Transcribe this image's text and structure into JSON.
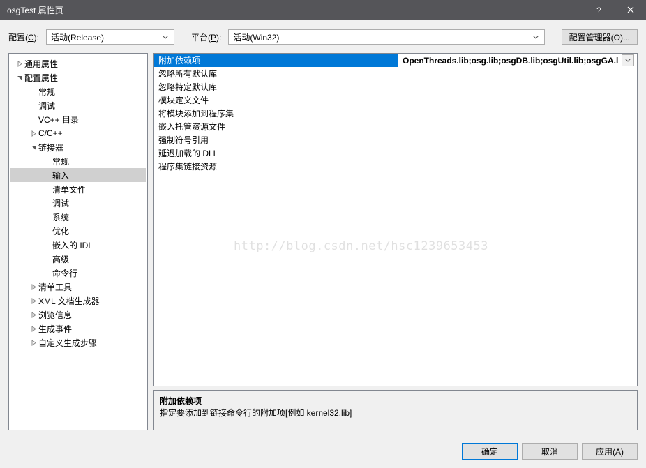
{
  "title": "osgTest 属性页",
  "toolbar": {
    "config_label": "配置(C):",
    "config_value": "活动(Release)",
    "platform_label": "平台(P):",
    "platform_value": "活动(Win32)",
    "manager_label": "配置管理器(O)..."
  },
  "tree": [
    {
      "depth": 0,
      "expander": ">",
      "label": "通用属性",
      "selected": false
    },
    {
      "depth": 0,
      "expander": "v",
      "label": "配置属性",
      "selected": false
    },
    {
      "depth": 1,
      "expander": "",
      "label": "常规",
      "selected": false
    },
    {
      "depth": 1,
      "expander": "",
      "label": "调试",
      "selected": false
    },
    {
      "depth": 1,
      "expander": "",
      "label": "VC++ 目录",
      "selected": false
    },
    {
      "depth": 1,
      "expander": ">",
      "label": "C/C++",
      "selected": false
    },
    {
      "depth": 1,
      "expander": "v",
      "label": "链接器",
      "selected": false
    },
    {
      "depth": 2,
      "expander": "",
      "label": "常规",
      "selected": false
    },
    {
      "depth": 2,
      "expander": "",
      "label": "输入",
      "selected": true
    },
    {
      "depth": 2,
      "expander": "",
      "label": "清单文件",
      "selected": false
    },
    {
      "depth": 2,
      "expander": "",
      "label": "调试",
      "selected": false
    },
    {
      "depth": 2,
      "expander": "",
      "label": "系统",
      "selected": false
    },
    {
      "depth": 2,
      "expander": "",
      "label": "优化",
      "selected": false
    },
    {
      "depth": 2,
      "expander": "",
      "label": "嵌入的 IDL",
      "selected": false
    },
    {
      "depth": 2,
      "expander": "",
      "label": "高级",
      "selected": false
    },
    {
      "depth": 2,
      "expander": "",
      "label": "命令行",
      "selected": false
    },
    {
      "depth": 1,
      "expander": ">",
      "label": "清单工具",
      "selected": false
    },
    {
      "depth": 1,
      "expander": ">",
      "label": "XML 文档生成器",
      "selected": false
    },
    {
      "depth": 1,
      "expander": ">",
      "label": "浏览信息",
      "selected": false
    },
    {
      "depth": 1,
      "expander": ">",
      "label": "生成事件",
      "selected": false
    },
    {
      "depth": 1,
      "expander": ">",
      "label": "自定义生成步骤",
      "selected": false
    }
  ],
  "grid": [
    {
      "key": "附加依赖项",
      "value": "OpenThreads.lib;osg.lib;osgDB.lib;osgUtil.lib;osgGA.lib;o",
      "selected": true,
      "hasDropdown": true
    },
    {
      "key": "忽略所有默认库",
      "value": "",
      "selected": false,
      "hasDropdown": false
    },
    {
      "key": "忽略特定默认库",
      "value": "",
      "selected": false,
      "hasDropdown": false
    },
    {
      "key": "模块定义文件",
      "value": "",
      "selected": false,
      "hasDropdown": false
    },
    {
      "key": "将模块添加到程序集",
      "value": "",
      "selected": false,
      "hasDropdown": false
    },
    {
      "key": "嵌入托管资源文件",
      "value": "",
      "selected": false,
      "hasDropdown": false
    },
    {
      "key": "强制符号引用",
      "value": "",
      "selected": false,
      "hasDropdown": false
    },
    {
      "key": "延迟加载的 DLL",
      "value": "",
      "selected": false,
      "hasDropdown": false
    },
    {
      "key": "程序集链接资源",
      "value": "",
      "selected": false,
      "hasDropdown": false
    }
  ],
  "help": {
    "title": "附加依赖项",
    "desc": "指定要添加到链接命令行的附加项[例如 kernel32.lib]"
  },
  "footer": {
    "ok": "确定",
    "cancel": "取消",
    "apply": "应用(A)"
  },
  "watermark": "http://blog.csdn.net/hsc1239653453"
}
